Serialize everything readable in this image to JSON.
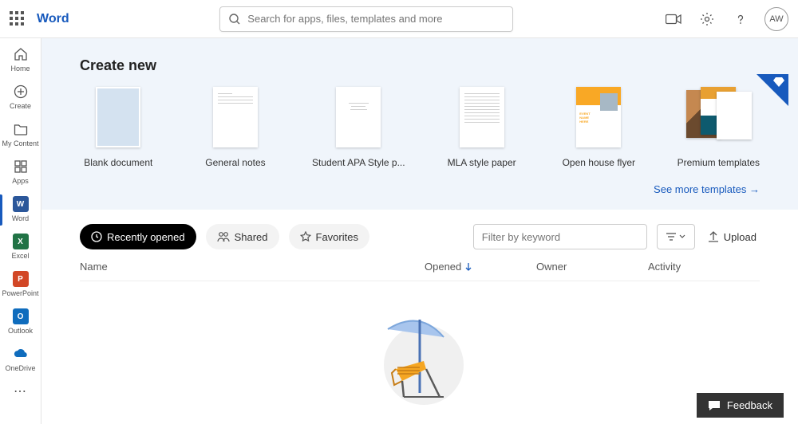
{
  "header": {
    "brand": "Word",
    "search_placeholder": "Search for apps, files, templates and more",
    "avatar_initials": "AW"
  },
  "sidebar": {
    "items": [
      {
        "label": "Home"
      },
      {
        "label": "Create"
      },
      {
        "label": "My Content"
      },
      {
        "label": "Apps"
      },
      {
        "label": "Word"
      },
      {
        "label": "Excel"
      },
      {
        "label": "PowerPoint"
      },
      {
        "label": "Outlook"
      },
      {
        "label": "OneDrive"
      }
    ]
  },
  "create": {
    "title": "Create new",
    "templates": [
      {
        "label": "Blank document"
      },
      {
        "label": "General notes"
      },
      {
        "label": "Student APA Style p..."
      },
      {
        "label": "MLA style paper"
      },
      {
        "label": "Open house flyer"
      },
      {
        "label": "Premium templates"
      }
    ],
    "flyer_line1": "EVENT",
    "flyer_line2": "NAME",
    "flyer_line3": "HERE",
    "see_more": "See more templates →"
  },
  "docs": {
    "tabs": {
      "recent": "Recently opened",
      "shared": "Shared",
      "favorites": "Favorites"
    },
    "filter_placeholder": "Filter by keyword",
    "upload_label": "Upload",
    "columns": {
      "name": "Name",
      "opened": "Opened",
      "owner": "Owner",
      "activity": "Activity"
    }
  },
  "feedback": {
    "label": "Feedback"
  }
}
